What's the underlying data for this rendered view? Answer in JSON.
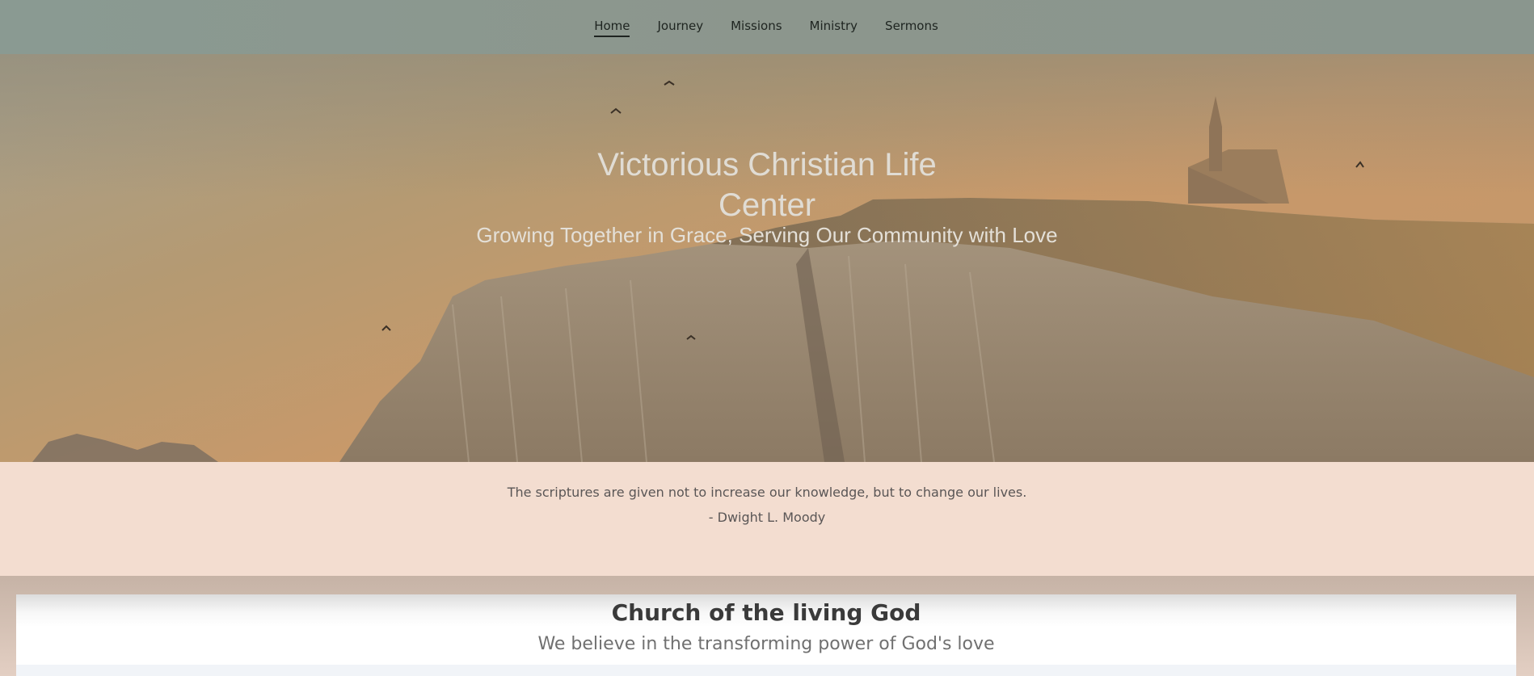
{
  "nav": {
    "items": [
      {
        "label": "Home",
        "active": true
      },
      {
        "label": "Journey",
        "active": false
      },
      {
        "label": "Missions",
        "active": false
      },
      {
        "label": "Ministry",
        "active": false
      },
      {
        "label": "Sermons",
        "active": false
      }
    ]
  },
  "hero": {
    "title_line1": "Victorious Christian Life",
    "title_line2": "Center",
    "subtitle": "Growing Together in Grace, Serving Our Community with Love",
    "background_image": "cliff-with-chapel-at-sunset"
  },
  "quote": {
    "text": "The scriptures are given not to increase our knowledge, but to change our lives.",
    "author": "- Dwight L. Moody"
  },
  "section": {
    "title": "Church of the living God",
    "subtitle": "We believe in the transforming power of God's love"
  },
  "colors": {
    "nav_bg": "#8a968e",
    "quote_bg": "#f3ddd0",
    "hero_text": "#e0dcd4"
  }
}
